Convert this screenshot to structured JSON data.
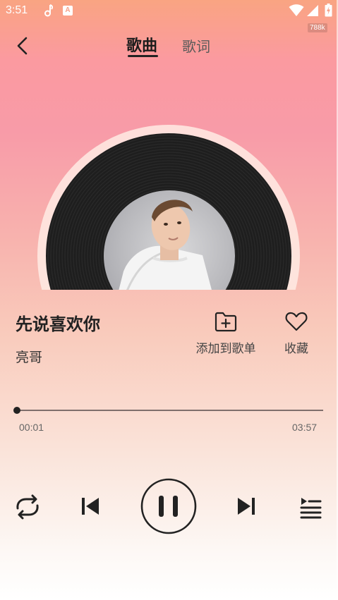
{
  "status_bar": {
    "time": "3:51",
    "badge_letter": "A",
    "net_speed": "788k"
  },
  "header": {
    "tabs": [
      {
        "label": "歌曲",
        "active": true
      },
      {
        "label": "歌词",
        "active": false
      }
    ]
  },
  "song": {
    "title": "先说喜欢你",
    "artist": "亮哥"
  },
  "actions": {
    "add_to_playlist": "添加到歌单",
    "favorite": "收藏"
  },
  "progress": {
    "current": "00:01",
    "total": "03:57",
    "fraction": 0.004
  },
  "controls": {
    "icons": [
      "back-icon",
      "repeat-icon",
      "previous-icon",
      "pause-icon",
      "next-icon",
      "queue-icon",
      "folder-add-icon",
      "heart-icon"
    ]
  },
  "colors": {
    "gradient_top": "#f9a482",
    "gradient_pink": "#f89ba8",
    "icon_dark": "#222222"
  }
}
